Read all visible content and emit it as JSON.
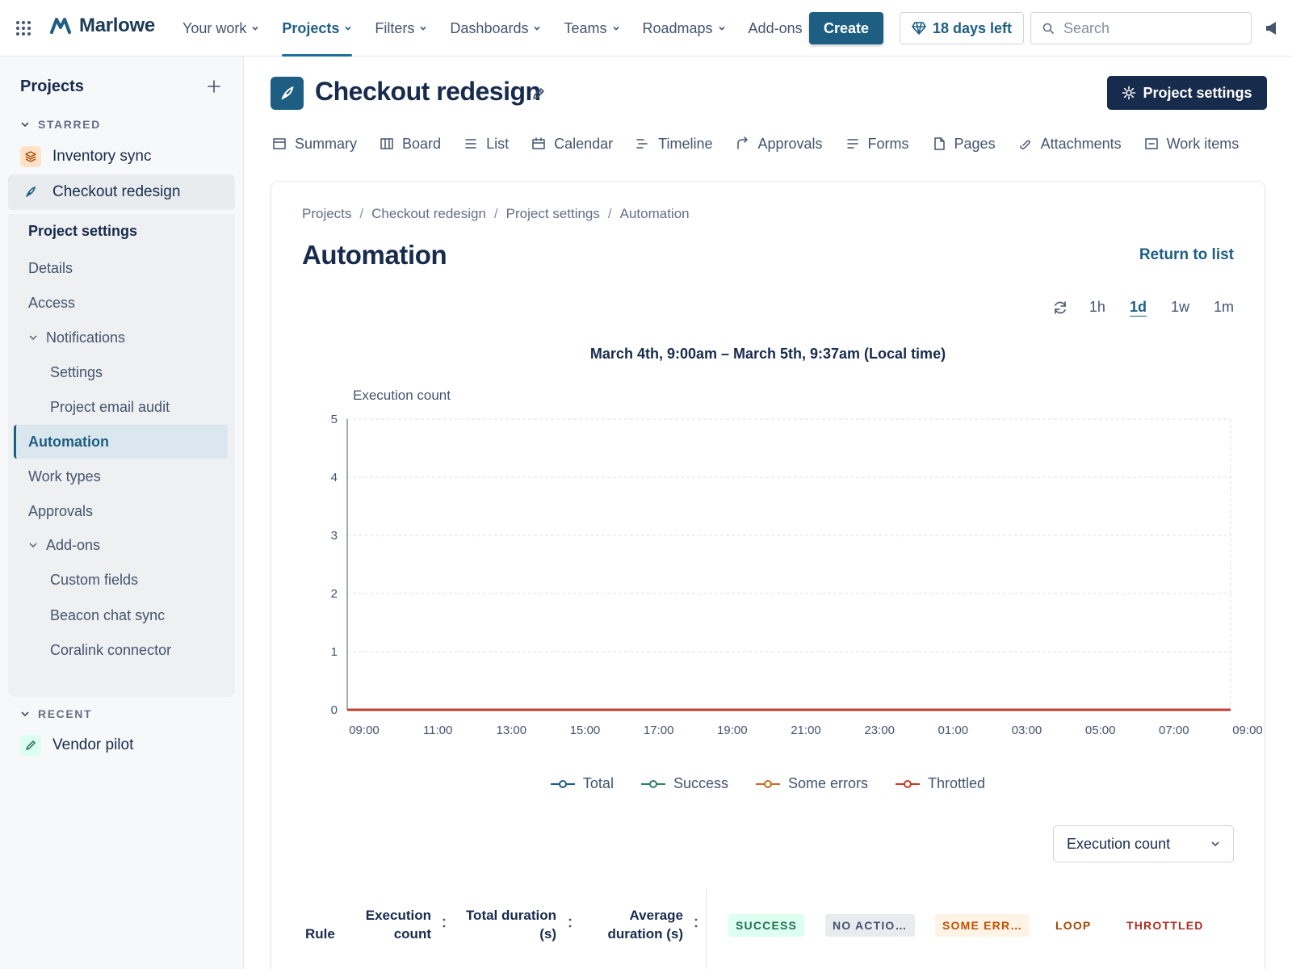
{
  "topnav": {
    "logo_text": "Marlowe",
    "items": [
      {
        "label": "Your work",
        "active": false
      },
      {
        "label": "Projects",
        "active": true
      },
      {
        "label": "Filters",
        "active": false
      },
      {
        "label": "Dashboards",
        "active": false
      },
      {
        "label": "Teams",
        "active": false
      },
      {
        "label": "Roadmaps",
        "active": false
      },
      {
        "label": "Add-ons",
        "active": false
      }
    ],
    "create_label": "Create",
    "trial_label": "18 days left",
    "search_placeholder": "Search"
  },
  "sidebar": {
    "header": "Projects",
    "starred_label": "STARRED",
    "recent_label": "RECENT",
    "starred": [
      {
        "label": "Inventory sync",
        "icon": "stack-icon"
      },
      {
        "label": "Checkout redesign",
        "icon": "feather-icon"
      }
    ],
    "recent": [
      {
        "label": "Vendor pilot",
        "icon": "pencil-icon"
      }
    ],
    "settings": {
      "title": "Project settings",
      "items": [
        "Details",
        "Access",
        "Notifications",
        "Settings",
        "Project email audit",
        "Automation",
        "Work types",
        "Approvals",
        "Add-ons",
        "Custom fields",
        "Beacon chat sync",
        "Coralink connector"
      ]
    }
  },
  "project": {
    "title": "Checkout redesign",
    "settings_button": "Project settings",
    "tabs": [
      "Summary",
      "Board",
      "List",
      "Calendar",
      "Timeline",
      "Approvals",
      "Forms",
      "Pages",
      "Attachments",
      "Work items"
    ]
  },
  "page": {
    "breadcrumb": [
      "Projects",
      "Checkout redesign",
      "Project settings",
      "Automation"
    ],
    "title": "Automation",
    "return_link": "Return to list",
    "ranges": [
      "1h",
      "1d",
      "1w",
      "1m"
    ],
    "selected_range": "1d",
    "date_range": "March 4th, 9:00am – March 5th, 9:37am (Local time)",
    "metric_select": "Execution count"
  },
  "chart_data": {
    "type": "line",
    "title": "",
    "ylabel": "Execution count",
    "xlabel": "",
    "x": [
      "09:00",
      "11:00",
      "13:00",
      "15:00",
      "17:00",
      "19:00",
      "21:00",
      "23:00",
      "01:00",
      "03:00",
      "05:00",
      "07:00",
      "09:00"
    ],
    "ylim": [
      0,
      5
    ],
    "yticks": [
      0,
      1,
      2,
      3,
      4,
      5
    ],
    "grid": true,
    "legend": "bottom",
    "series": [
      {
        "name": "Total",
        "color": "#1d5e82",
        "values": [
          0,
          0,
          0,
          0,
          0,
          0,
          0,
          0,
          0,
          0,
          0,
          0,
          0
        ]
      },
      {
        "name": "Success",
        "color": "#2e7d6b",
        "values": [
          0,
          0,
          0,
          0,
          0,
          0,
          0,
          0,
          0,
          0,
          0,
          0,
          0
        ]
      },
      {
        "name": "Some errors",
        "color": "#c96a1c",
        "values": [
          0,
          0,
          0,
          0,
          0,
          0,
          0,
          0,
          0,
          0,
          0,
          0,
          0
        ]
      },
      {
        "name": "Throttled",
        "color": "#c9372c",
        "values": [
          0,
          0,
          0,
          0,
          0,
          0,
          0,
          0,
          0,
          0,
          0,
          0,
          0
        ]
      }
    ]
  },
  "table": {
    "headers": {
      "rule": "Rule",
      "exec_count_1": "Execution",
      "exec_count_2": "count",
      "total_dur_1": "Total duration",
      "total_dur_2": "(s)",
      "avg_dur_1": "Average",
      "avg_dur_2": "duration (s)"
    },
    "status_columns": [
      {
        "label": "SUCCESS",
        "color": "#216e4e",
        "bg": "#dcfff1"
      },
      {
        "label": "NO ACTIO…",
        "color": "#44546f",
        "bg": "#e9ecef"
      },
      {
        "label": "SOME ERR…",
        "color": "#c25100",
        "bg": "#fff3e6"
      },
      {
        "label": "LOOP",
        "color": "#a54800",
        "bg": "transparent"
      },
      {
        "label": "THROTTLED",
        "color": "#ae2e24",
        "bg": "transparent"
      }
    ]
  }
}
